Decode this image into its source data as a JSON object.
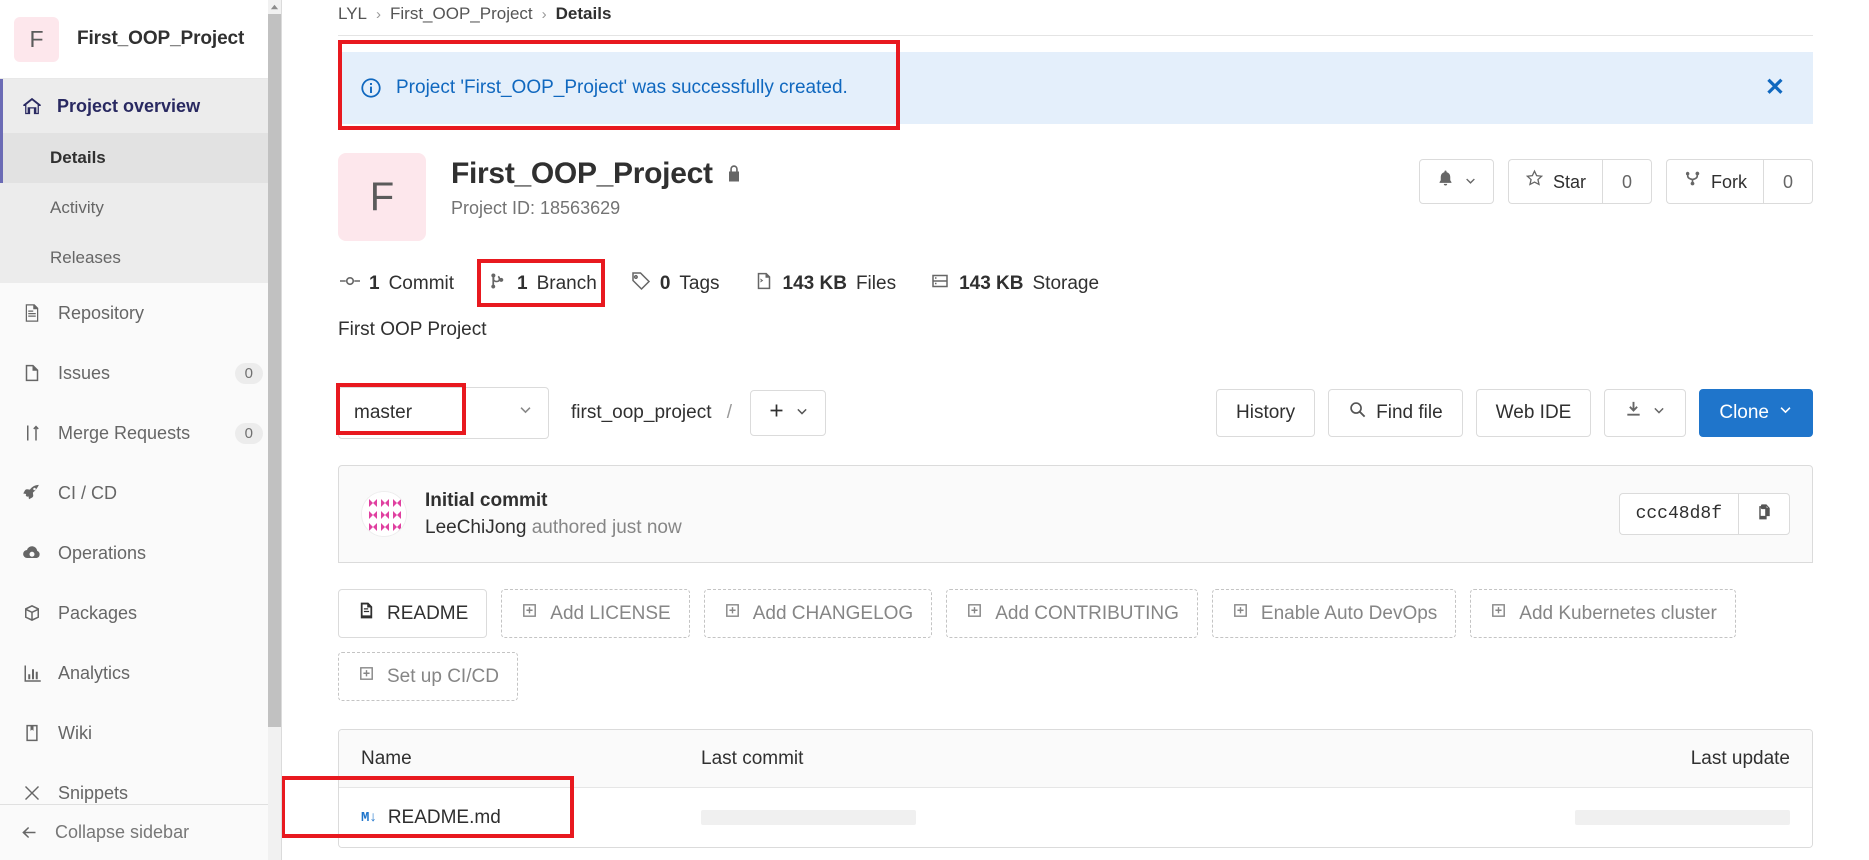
{
  "sidebar": {
    "project_initial": "F",
    "project_name": "First_OOP_Project",
    "overview": {
      "label": "Project overview",
      "icon": "home-icon"
    },
    "sub_items": [
      {
        "label": "Details",
        "active": true
      },
      {
        "label": "Activity",
        "active": false
      },
      {
        "label": "Releases",
        "active": false
      }
    ],
    "items": [
      {
        "label": "Repository",
        "icon": "repository-icon",
        "badge": ""
      },
      {
        "label": "Issues",
        "icon": "issues-icon",
        "badge": "0"
      },
      {
        "label": "Merge Requests",
        "icon": "merge-request-icon",
        "badge": "0"
      },
      {
        "label": "CI / CD",
        "icon": "rocket-icon",
        "badge": ""
      },
      {
        "label": "Operations",
        "icon": "cloud-gear-icon",
        "badge": ""
      },
      {
        "label": "Packages",
        "icon": "package-icon",
        "badge": ""
      },
      {
        "label": "Analytics",
        "icon": "chart-icon",
        "badge": ""
      },
      {
        "label": "Wiki",
        "icon": "book-icon",
        "badge": ""
      },
      {
        "label": "Snippets",
        "icon": "snippet-icon",
        "badge": ""
      }
    ],
    "collapse_label": "Collapse sidebar"
  },
  "breadcrumb": {
    "group": "LYL",
    "project": "First_OOP_Project",
    "current": "Details",
    "separator": "›"
  },
  "alert": {
    "message": "Project 'First_OOP_Project' was successfully created.",
    "close_label": "✕",
    "bg_color": "#e4effb",
    "text_color": "#1068bf"
  },
  "project": {
    "initial": "F",
    "name": "First_OOP_Project",
    "visibility": "private",
    "id_label": "Project ID: 18563629",
    "description": "First OOP Project",
    "avatar_bg": "#fde7ec"
  },
  "project_actions": {
    "notification_label": "",
    "star_label": "Star",
    "star_count": "0",
    "fork_label": "Fork",
    "fork_count": "0"
  },
  "stats": [
    {
      "icon": "commit-icon",
      "value": "1",
      "label": "Commit"
    },
    {
      "icon": "branch-icon",
      "value": "1",
      "label": "Branch"
    },
    {
      "icon": "tag-icon",
      "value": "0",
      "label": "Tags"
    },
    {
      "icon": "file-icon",
      "value": "143 KB",
      "label": "Files"
    },
    {
      "icon": "storage-icon",
      "value": "143 KB",
      "label": "Storage"
    }
  ],
  "file_toolbar": {
    "branch": "master",
    "path": "first_oop_project",
    "path_separator": "/",
    "add_label": "+",
    "history_label": "History",
    "find_file_label": "Find file",
    "web_ide_label": "Web IDE",
    "download_label": "",
    "clone_label": "Clone",
    "clone_color": "#1f75cb"
  },
  "commit": {
    "title": "Initial commit",
    "author": "LeeChiJong",
    "meta": "authored just now",
    "sha": "ccc48d8f"
  },
  "quick_actions": [
    {
      "label": "README",
      "style": "solid",
      "icon": "doc-icon"
    },
    {
      "label": "Add LICENSE",
      "style": "dashed",
      "icon": "plus-box-icon"
    },
    {
      "label": "Add CHANGELOG",
      "style": "dashed",
      "icon": "plus-box-icon"
    },
    {
      "label": "Add CONTRIBUTING",
      "style": "dashed",
      "icon": "plus-box-icon"
    },
    {
      "label": "Enable Auto DevOps",
      "style": "dashed",
      "icon": "plus-box-icon"
    },
    {
      "label": "Add Kubernetes cluster",
      "style": "dashed",
      "icon": "plus-box-icon"
    },
    {
      "label": "Set up CI/CD",
      "style": "dashed",
      "icon": "plus-box-icon"
    }
  ],
  "file_table": {
    "headers": {
      "name": "Name",
      "last_commit": "Last commit",
      "last_update": "Last update"
    },
    "rows": [
      {
        "name": "README.md",
        "icon": "markdown-icon",
        "last_commit": "",
        "last_update": ""
      }
    ]
  },
  "highlights": {
    "accent": "#e8191f"
  }
}
